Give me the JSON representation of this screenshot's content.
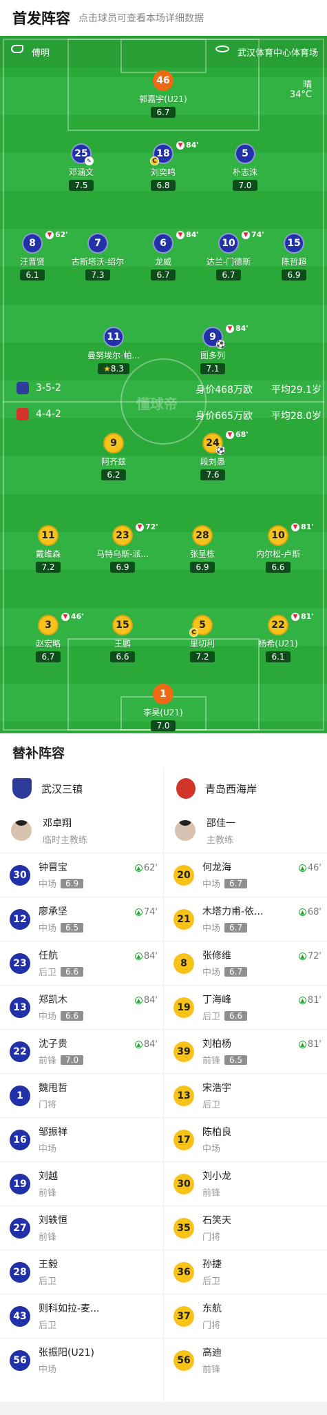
{
  "header": {
    "title": "首发阵容",
    "subtitle": "点击球员可查看本场详细数据"
  },
  "pitch_info": {
    "weather_label": "晴",
    "temperature": "34°C",
    "referee": "傅明",
    "stadium": "武汉体育中心体育场",
    "watermark": "懂球帝"
  },
  "colors": {
    "home": "#2131a8",
    "away": "#f7c31b",
    "pitch": "#2aa838",
    "keeper": "#ef6a14"
  },
  "home_team": {
    "name": "武汉三镇",
    "formation": "3-5-2",
    "value": "身价468万欧",
    "avg_age": "平均29.1岁",
    "lineup": [
      {
        "num": "46",
        "name": "郭嘉宇(U21)",
        "rating": "6.7",
        "gk": true
      },
      {
        "num": "25",
        "name": "邓涵文",
        "rating": "7.5"
      },
      {
        "num": "18",
        "name": "刘奕鸣",
        "rating": "6.8",
        "sub_min": "84'",
        "captain": "C"
      },
      {
        "num": "5",
        "name": "朴志洙",
        "rating": "7.0"
      },
      {
        "num": "8",
        "name": "汪晋贤",
        "rating": "6.1",
        "sub_min": "62'"
      },
      {
        "num": "7",
        "name": "古斯塔沃-绍尔",
        "rating": "7.3"
      },
      {
        "num": "6",
        "name": "龙威",
        "rating": "6.7",
        "sub_min": "84'"
      },
      {
        "num": "10",
        "name": "达兰-门德斯",
        "rating": "6.7",
        "sub_min": "74'"
      },
      {
        "num": "15",
        "name": "陈哲超",
        "rating": "6.9"
      },
      {
        "num": "11",
        "name": "曼努埃尔-帕...",
        "rating": "8.3",
        "star": true
      },
      {
        "num": "9",
        "name": "图多列",
        "rating": "7.1",
        "sub_min": "84'",
        "goal": true
      }
    ]
  },
  "away_team": {
    "name": "青岛西海岸",
    "formation": "4-4-2",
    "value": "身价665万欧",
    "avg_age": "平均28.0岁",
    "lineup": [
      {
        "num": "9",
        "name": "阿齐兹",
        "rating": "6.2"
      },
      {
        "num": "24",
        "name": "段刘愚",
        "rating": "7.6",
        "sub_min": "68'",
        "goal": true
      },
      {
        "num": "11",
        "name": "戴维森",
        "rating": "7.2"
      },
      {
        "num": "23",
        "name": "马特乌斯-派...",
        "rating": "6.9",
        "sub_min": "72'"
      },
      {
        "num": "28",
        "name": "张呈栋",
        "rating": "6.9"
      },
      {
        "num": "10",
        "name": "内尔松-卢斯",
        "rating": "6.6",
        "sub_min": "81'"
      },
      {
        "num": "3",
        "name": "赵宏略",
        "rating": "6.7",
        "sub_min": "46'"
      },
      {
        "num": "15",
        "name": "王鹏",
        "rating": "6.6"
      },
      {
        "num": "5",
        "name": "里切利",
        "rating": "7.2",
        "captain": "C"
      },
      {
        "num": "22",
        "name": "杨希(U21)",
        "rating": "6.1",
        "sub_min": "81'"
      },
      {
        "num": "1",
        "name": "李昊(U21)",
        "rating": "7.0",
        "gk": true
      }
    ]
  },
  "bench": {
    "title": "替补阵容",
    "home": {
      "team": "武汉三镇",
      "coach": {
        "name": "邓卓翔",
        "role": "临时主教练"
      },
      "players": [
        {
          "num": "30",
          "name": "钟晋宝",
          "pos": "中场",
          "rating": "6.9",
          "sub_min": "62'"
        },
        {
          "num": "12",
          "name": "廖承坚",
          "pos": "中场",
          "rating": "6.5",
          "sub_min": "74'"
        },
        {
          "num": "23",
          "name": "任航",
          "pos": "后卫",
          "rating": "6.6",
          "sub_min": "84'"
        },
        {
          "num": "13",
          "name": "郑凯木",
          "pos": "中场",
          "rating": "6.6",
          "sub_min": "84'"
        },
        {
          "num": "22",
          "name": "沈子贵",
          "pos": "前锋",
          "rating": "7.0",
          "sub_min": "84'"
        },
        {
          "num": "1",
          "name": "魏甩哲",
          "pos": "门将"
        },
        {
          "num": "16",
          "name": "邹振祥",
          "pos": "中场"
        },
        {
          "num": "19",
          "name": "刘越",
          "pos": "前锋"
        },
        {
          "num": "27",
          "name": "刘轶恒",
          "pos": "前锋"
        },
        {
          "num": "28",
          "name": "王毅",
          "pos": "后卫"
        },
        {
          "num": "43",
          "name": "则科如拉-麦...",
          "pos": "后卫"
        },
        {
          "num": "56",
          "name": "张振阳(U21)",
          "pos": "中场"
        }
      ]
    },
    "away": {
      "team": "青岛西海岸",
      "coach": {
        "name": "邵佳一",
        "role": "主教练"
      },
      "players": [
        {
          "num": "20",
          "name": "何龙海",
          "pos": "中场",
          "rating": "6.7",
          "sub_min": "46'"
        },
        {
          "num": "21",
          "name": "木塔力甫-依...",
          "pos": "中场",
          "rating": "6.7",
          "sub_min": "68'"
        },
        {
          "num": "8",
          "name": "张修维",
          "pos": "中场",
          "rating": "6.7",
          "sub_min": "72'"
        },
        {
          "num": "19",
          "name": "丁海峰",
          "pos": "后卫",
          "rating": "6.6",
          "sub_min": "81'"
        },
        {
          "num": "39",
          "name": "刘柏杨",
          "pos": "前锋",
          "rating": "6.5",
          "sub_min": "81'"
        },
        {
          "num": "13",
          "name": "宋浩宇",
          "pos": "后卫"
        },
        {
          "num": "17",
          "name": "陈柏良",
          "pos": "中场"
        },
        {
          "num": "30",
          "name": "刘小龙",
          "pos": "前锋"
        },
        {
          "num": "35",
          "name": "石笑天",
          "pos": "门将"
        },
        {
          "num": "36",
          "name": "孙捷",
          "pos": "后卫"
        },
        {
          "num": "37",
          "name": "东航",
          "pos": "门将"
        },
        {
          "num": "56",
          "name": "高迪",
          "pos": "前锋"
        }
      ]
    }
  }
}
